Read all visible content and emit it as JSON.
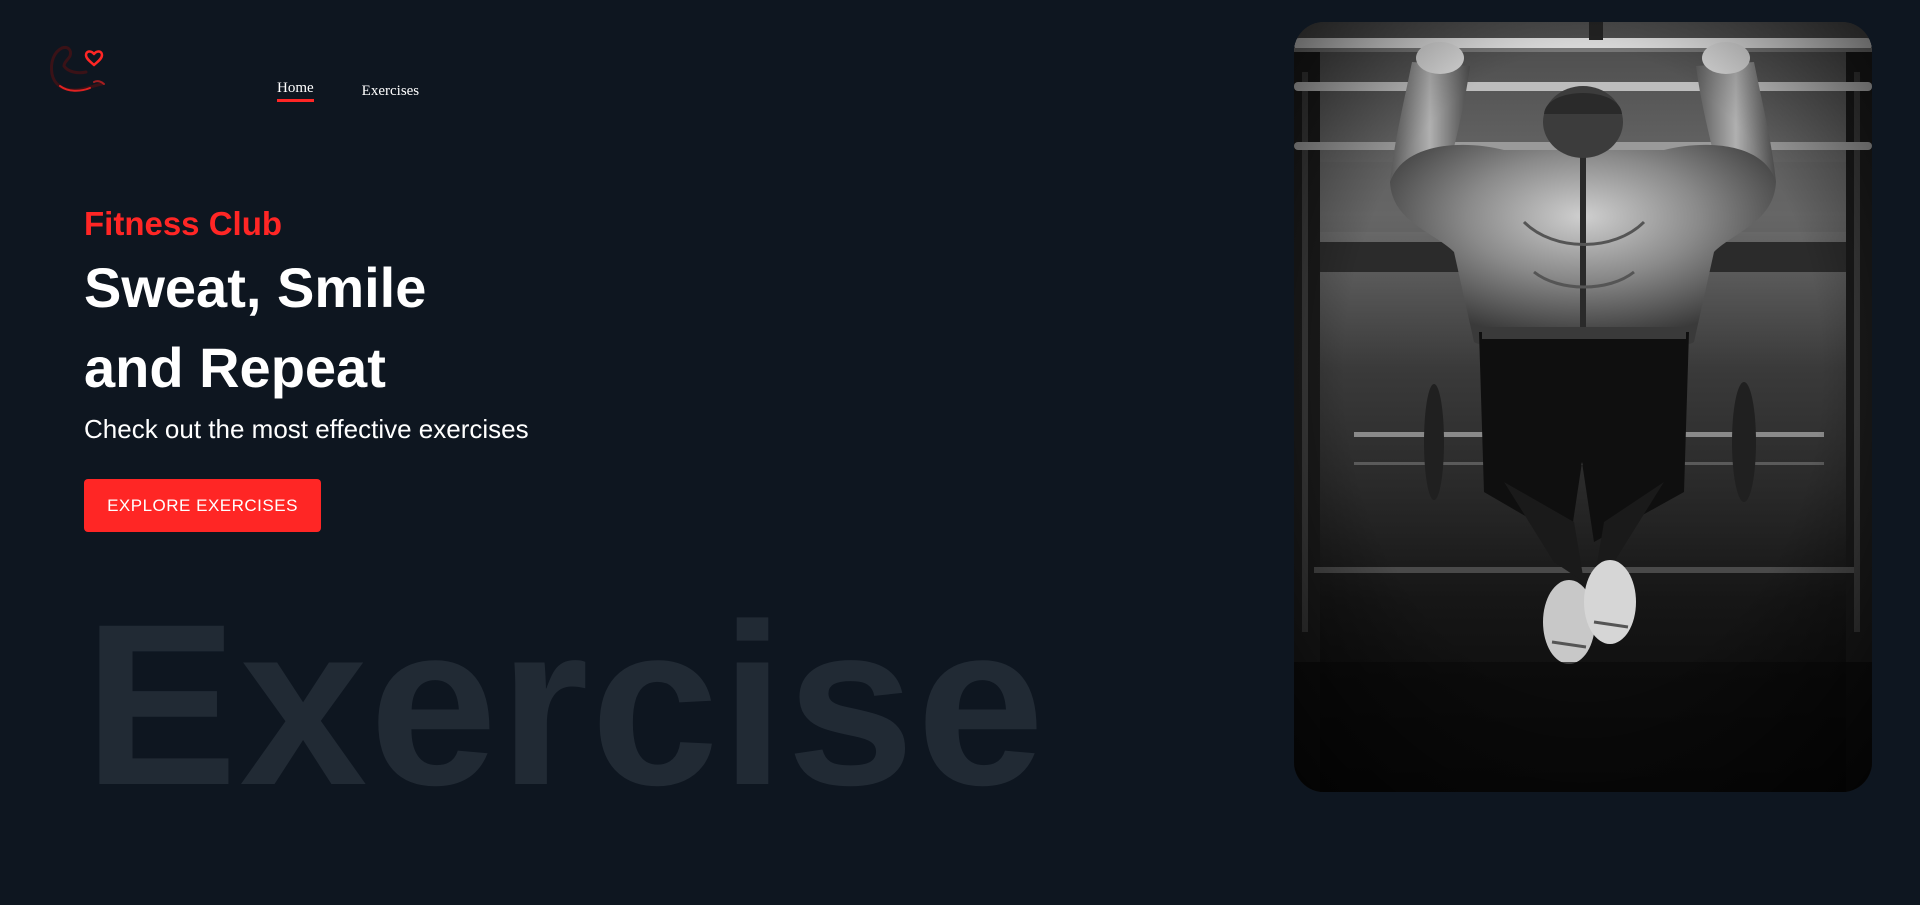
{
  "logo": {
    "icon": "flexed-arm-heart-icon",
    "accent": "#ff2625"
  },
  "nav": {
    "items": [
      {
        "label": "Home",
        "active": true
      },
      {
        "label": "Exercises",
        "active": false
      }
    ]
  },
  "hero": {
    "eyebrow": "Fitness Club",
    "headline_line1": "Sweat, Smile",
    "headline_line2": "and Repeat",
    "subtitle": "Check out the most effective exercises",
    "cta_label": "EXPLORE EXERCISES",
    "watermark": "Exercise",
    "image": {
      "subject": "athlete-doing-pull-ups",
      "style": "black-and-white photo"
    }
  },
  "colors": {
    "background": "#0e1620",
    "accent": "#ff2625",
    "text": "#ffffff",
    "watermark": "#212a34"
  }
}
